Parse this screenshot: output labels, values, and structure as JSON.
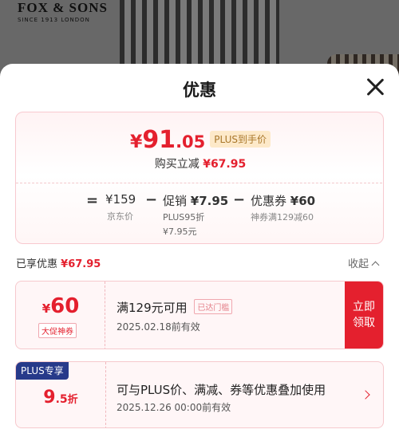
{
  "background": {
    "brand_name": "FOX & SONS",
    "brand_since": "SINCE 1913 LONDON"
  },
  "sheet": {
    "title": "优惠"
  },
  "summary": {
    "price_currency": "¥",
    "price_integer": "91",
    "price_decimal": ".05",
    "plus_label": "PLUS到手价",
    "reduce_label": "购买立减",
    "reduce_amount": "¥67.95",
    "formula": {
      "eq": "=",
      "minus1": "−",
      "minus2": "−",
      "jd_price_value": "¥159",
      "jd_price_label": "京东价",
      "promo_label": "促销",
      "promo_value": "¥7.95",
      "promo_sub1": "PLUS95折",
      "promo_sub2": "¥7.95元",
      "coupon_label": "优惠券",
      "coupon_value": "¥60",
      "coupon_sub": "神券满129减60"
    }
  },
  "enjoyed": {
    "label": "已享优惠",
    "amount": "¥67.95",
    "collapse_label": "收起"
  },
  "coupons": [
    {
      "currency": "¥",
      "value": "60",
      "tag": "大促神券",
      "condition": "满129元可用",
      "badge": "已达门槛",
      "valid": "2025.02.18前有效",
      "claim_line1": "立即",
      "claim_line2": "领取"
    },
    {
      "plus_badge": "PLUS专享",
      "value_main": "9",
      "value_small": ".5",
      "value_unit": "折",
      "description": "可与PLUS价、满减、券等优惠叠加使用",
      "valid": "2025.12.26 00:00前有效"
    }
  ],
  "colors": {
    "accent_red": "#e4202e",
    "plus_blue": "#273a8a",
    "plus_gold_bg": "#fde9c9"
  }
}
